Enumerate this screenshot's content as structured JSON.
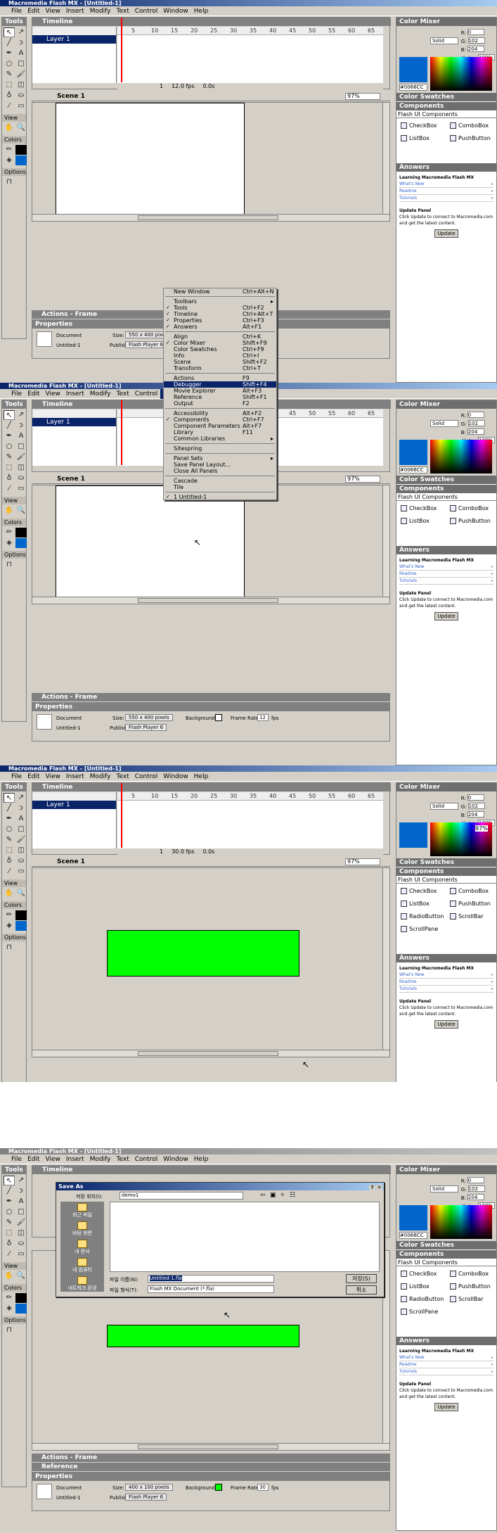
{
  "app": {
    "title": "Macromedia Flash MX - [Untitled-1]",
    "menu": [
      "File",
      "Edit",
      "View",
      "Insert",
      "Modify",
      "Text",
      "Control",
      "Window",
      "Help"
    ]
  },
  "panels": {
    "tools": "Tools",
    "timeline": "Timeline",
    "view": "View",
    "colors": "Colors",
    "options": "Options",
    "scene": "Scene 1",
    "zoom": "97%",
    "actions_frame": "Actions - Frame",
    "properties": "Properties",
    "reference": "Reference",
    "color_mixer": "Color Mixer",
    "color_swatches": "Color Swatches",
    "components": "Components",
    "answers": "Answers"
  },
  "timeline": {
    "layer": "Layer 1",
    "ruler": [
      "5",
      "10",
      "15",
      "20",
      "25",
      "30",
      "35",
      "40",
      "45",
      "50",
      "55",
      "60",
      "65"
    ],
    "frame": "1",
    "fps_1": "12.0 fps",
    "fps_3": "30.0 fps",
    "time": "0.0s"
  },
  "properties": {
    "document": "Document",
    "doc_name": "Untitled-1",
    "size_label": "Size:",
    "size_1": "550 x 400 pixels",
    "size_4": "400 x 100 pixels",
    "publish_label": "Publish:",
    "publish_btn": "Flash Player 6",
    "bg_label": "Background:",
    "fr_label": "Frame Rate:",
    "fr_1": "12",
    "fr_4": "30",
    "fps": "fps"
  },
  "mixer": {
    "r": "0",
    "g": "102",
    "b": "204",
    "alpha": "100%",
    "fill": "Solid",
    "hex": "#0066CC",
    "r_lbl": "R:",
    "g_lbl": "G:",
    "b_lbl": "B:",
    "a_lbl": "Alpha:",
    "alpha_overlay": "97%"
  },
  "components": {
    "group": "Flash UI Components",
    "items": [
      "CheckBox",
      "ComboBox",
      "ListBox",
      "PushButton",
      "RadioButton",
      "ScrollBar",
      "ScrollPane"
    ]
  },
  "answers": {
    "heading": "Learning Macromedia Flash MX",
    "links": [
      "What's New",
      "Readme",
      "Tutorials"
    ],
    "update_heading": "Update Panel",
    "update_text": "Click Update to connect to Macromedia.com and get the latest content.",
    "update_btn": "Update"
  },
  "window_menu": [
    {
      "label": "New Window",
      "sc": "Ctrl+Alt+N"
    },
    {
      "sep": true
    },
    {
      "label": "Toolbars",
      "sub": true
    },
    {
      "label": "Tools",
      "sc": "Ctrl+F2",
      "chk": true
    },
    {
      "label": "Timeline",
      "sc": "Ctrl+Alt+T",
      "chk": true
    },
    {
      "label": "Properties",
      "sc": "Ctrl+F3",
      "chk": true
    },
    {
      "label": "Answers",
      "sc": "Alt+F1",
      "chk": true
    },
    {
      "sep": true
    },
    {
      "label": "Align",
      "sc": "Ctrl+K"
    },
    {
      "label": "Color Mixer",
      "sc": "Shift+F9",
      "chk": true
    },
    {
      "label": "Color Swatches",
      "sc": "Ctrl+F9"
    },
    {
      "label": "Info",
      "sc": "Ctrl+I"
    },
    {
      "label": "Scene",
      "sc": "Shift+F2"
    },
    {
      "label": "Transform",
      "sc": "Ctrl+T"
    },
    {
      "sep": true
    },
    {
      "label": "Actions",
      "sc": "F9"
    },
    {
      "label": "Debugger",
      "sc": "Shift+F4",
      "hl": true
    },
    {
      "label": "Movie Explorer",
      "sc": "Alt+F3"
    },
    {
      "label": "Reference",
      "sc": "Shift+F1"
    },
    {
      "label": "Output",
      "sc": "F2"
    },
    {
      "sep": true
    },
    {
      "label": "Accessibility",
      "sc": "Alt+F2"
    },
    {
      "label": "Components",
      "sc": "Ctrl+F7",
      "chk": true
    },
    {
      "label": "Component Parameters",
      "sc": "Alt+F7"
    },
    {
      "label": "Library",
      "sc": "F11"
    },
    {
      "label": "Common Libraries",
      "sub": true
    },
    {
      "sep": true
    },
    {
      "label": "Sitespring"
    },
    {
      "sep": true
    },
    {
      "label": "Panel Sets",
      "sub": true
    },
    {
      "label": "Save Panel Layout..."
    },
    {
      "label": "Close All Panels"
    },
    {
      "sep": true
    },
    {
      "label": "Cascade"
    },
    {
      "label": "Tile"
    },
    {
      "sep": true
    },
    {
      "label": "1 Untitled-1",
      "chk": true
    }
  ],
  "save_dialog": {
    "title": "Save As",
    "look_in_label": "저장 위치(I):",
    "folder": "demo1",
    "places": [
      "최근 파일",
      "바탕 화면",
      "내 문서",
      "내 컴퓨터",
      "네트워크 환경"
    ],
    "filename_label": "파일 이름(N):",
    "filename": "Untitled-1.fla",
    "filetype_label": "파일 형식(T):",
    "filetype": "Flash MX Document (*.fla)",
    "save_btn": "저장(S)",
    "cancel_btn": "취소"
  },
  "colors": {
    "green": "#00ff00",
    "blue": "#0066cc",
    "titlebar": "#0a246a"
  }
}
